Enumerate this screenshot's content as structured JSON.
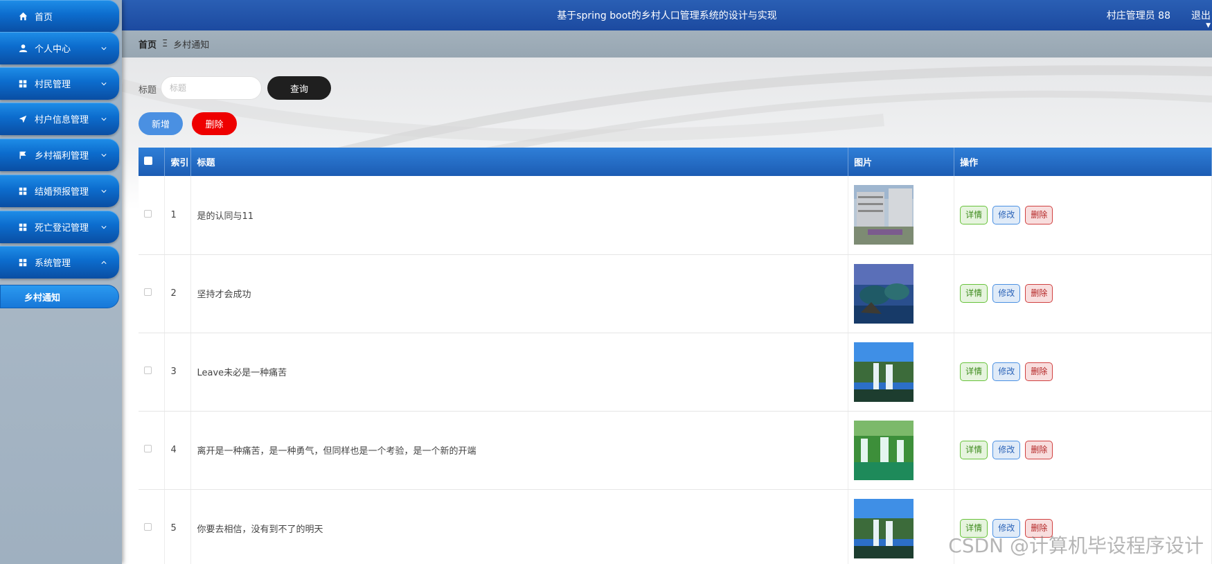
{
  "header": {
    "title": "基于spring boot的乡村人口管理系统的设计与实现",
    "user": "村庄管理员 88",
    "logout": "退出"
  },
  "breadcrumb": {
    "home": "首页",
    "separator": "Ξ",
    "current": "乡村通知"
  },
  "sidebar": {
    "items": [
      {
        "label": "首页",
        "icon": "home-icon"
      },
      {
        "label": "个人中心",
        "icon": "user-icon"
      },
      {
        "label": "村民管理",
        "icon": "grid-icon"
      },
      {
        "label": "村户信息管理",
        "icon": "send-icon"
      },
      {
        "label": "乡村福利管理",
        "icon": "flag-icon"
      },
      {
        "label": "结婚预报管理",
        "icon": "grid-icon"
      },
      {
        "label": "死亡登记管理",
        "icon": "grid-icon"
      },
      {
        "label": "系统管理",
        "icon": "grid-icon"
      }
    ],
    "sub_item": "乡村通知"
  },
  "search": {
    "label": "标题",
    "placeholder": "标题",
    "query_button": "查询"
  },
  "actions": {
    "add": "新增",
    "delete": "删除"
  },
  "table": {
    "headers": {
      "index": "索引",
      "title": "标题",
      "image": "图片",
      "ops": "操作"
    },
    "rows": [
      {
        "index": "1",
        "title": "是的认同与11"
      },
      {
        "index": "2",
        "title": "坚持才会成功"
      },
      {
        "index": "3",
        "title": "Leave未必是一种痛苦"
      },
      {
        "index": "4",
        "title": "离开是一种痛苦，是一种勇气，但同样也是一个考验，是一个新的开端"
      },
      {
        "index": "5",
        "title": "你要去相信，没有到不了的明天"
      }
    ],
    "op_labels": {
      "detail": "详情",
      "edit": "修改",
      "delete": "删除"
    }
  },
  "watermark": "CSDN @计算机毕设程序设计",
  "colors": {
    "topbar": "#1c4aa0",
    "menu": "#0c6ccd",
    "add": "#4a90e2",
    "delete": "#ee0000",
    "query": "#1f1f1f"
  }
}
